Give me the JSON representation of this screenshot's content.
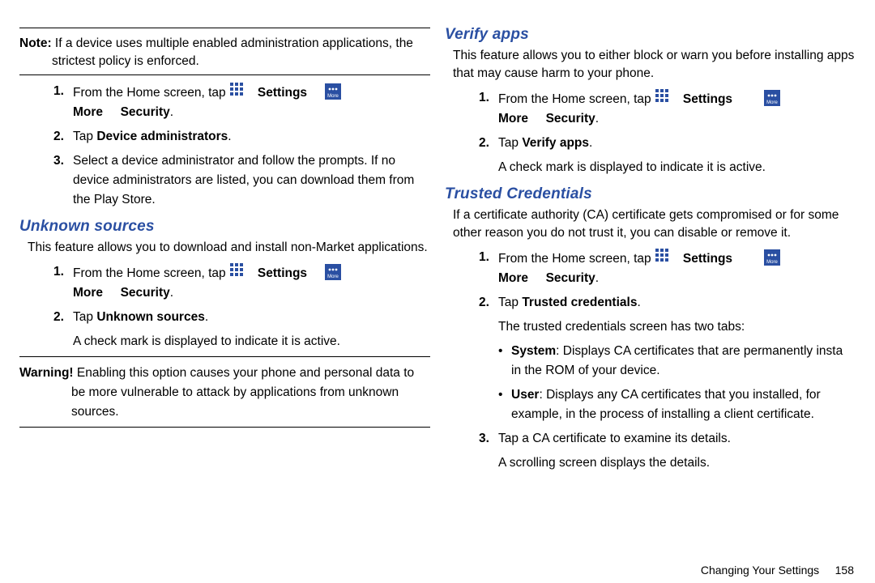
{
  "left": {
    "note_label": "Note:",
    "note_text": "If a device uses multiple enabled administration applications, the strictest policy is enforced.",
    "admin": {
      "step1_pre": "From the Home screen, tap",
      "settings": "Settings",
      "arrow": "➔",
      "more": "More",
      "security": "Security",
      "step2_pre": "Tap",
      "step2_bold": "Device administrators",
      "step3": "Select a device administrator and follow the prompts. If no device administrators are listed, you can download them from the Play Store."
    },
    "unknown": {
      "title": "Unknown sources",
      "intro": "This feature allows you to download and install non-Market applications.",
      "step1_pre": "From the Home screen, tap",
      "settings": "Settings",
      "more": "More",
      "security": "Security",
      "step2_pre": "Tap",
      "step2_bold": "Unknown sources",
      "after": "A check mark is displayed to indicate it is active."
    },
    "warning_label": "Warning!",
    "warning_text": "Enabling this option causes your phone and personal data to be more vulnerable to attack by applications from unknown sources."
  },
  "right": {
    "verify": {
      "title": "Verify apps",
      "intro": "This feature allows you to either block or warn you before installing apps that may cause harm to your phone.",
      "step1_pre": "From the Home screen, tap",
      "settings": "Settings",
      "more": "More",
      "security": "Security",
      "step2_pre": "Tap",
      "step2_bold": "Verify apps",
      "after": "A check mark is displayed to indicate it is active."
    },
    "trusted": {
      "title": "Trusted Credentials",
      "intro": "If a certificate authority (CA) certificate gets compromised or for some other reason you do not trust it, you can disable or remove it.",
      "step1_pre": "From the Home screen, tap",
      "settings": "Settings",
      "more": "More",
      "security": "Security",
      "step2_pre": "Tap",
      "step2_bold": "Trusted credentials",
      "after2": "The trusted credentials screen has two tabs:",
      "bullet1_bold": "System",
      "bullet1_text": ": Displays CA certificates that are permanently insta in the ROM of your device.",
      "bullet2_bold": "User",
      "bullet2_text": ": Displays any CA certificates that you installed, for example, in the process of installing a client certificate.",
      "step3": "Tap a CA certificate to examine its details.",
      "after3": "A scrolling screen displays the details."
    }
  },
  "footer": {
    "chapter": "Changing Your Settings",
    "page": "158"
  },
  "nums": {
    "n1": "1.",
    "n2": "2.",
    "n3": "3."
  }
}
